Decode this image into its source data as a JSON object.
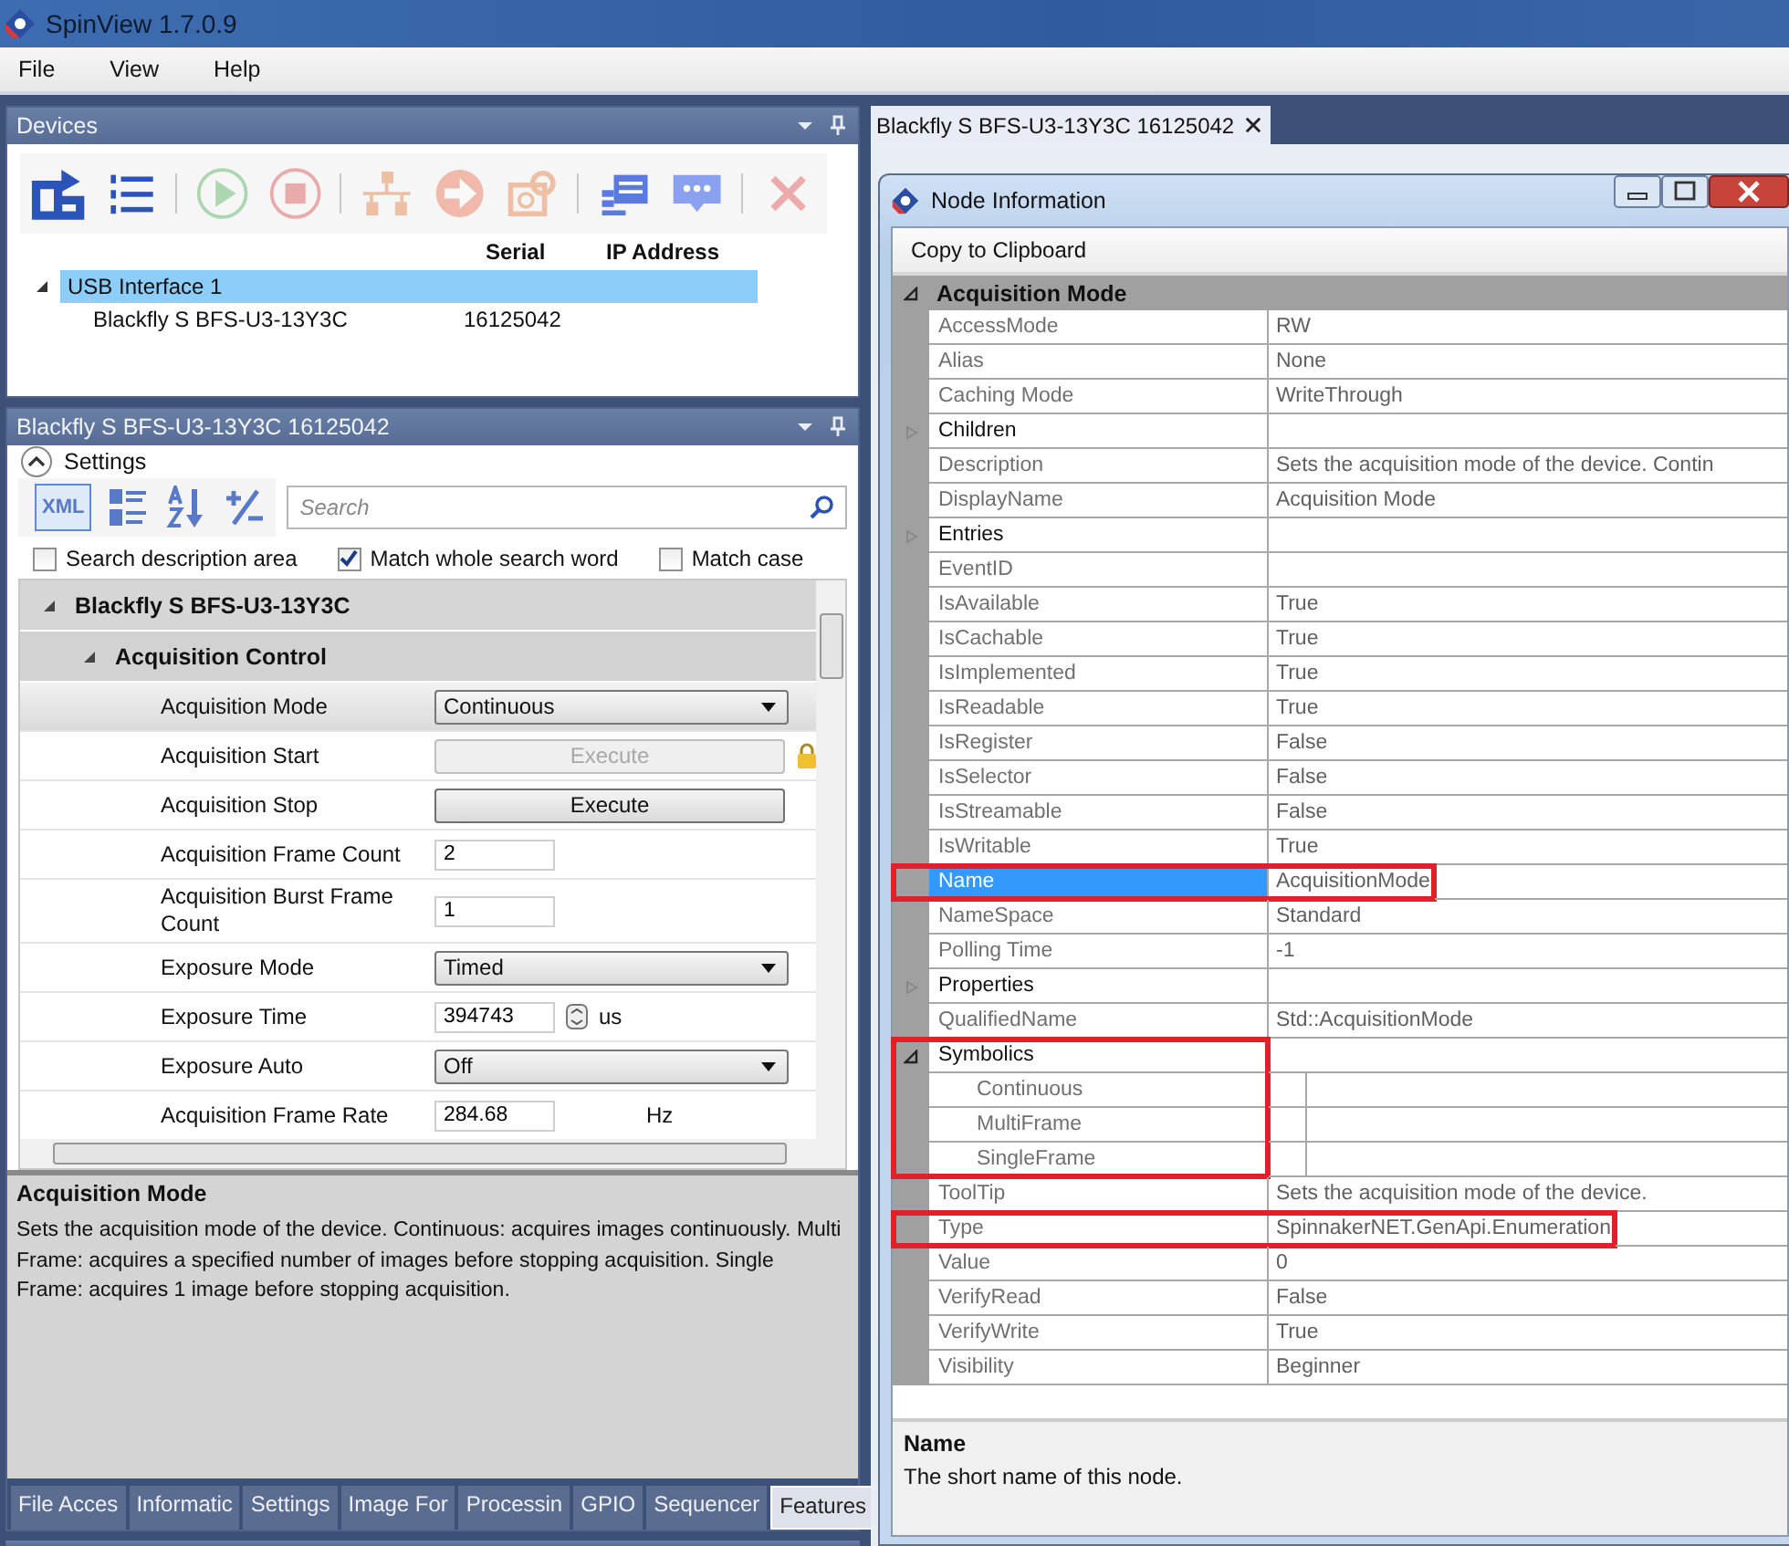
{
  "window": {
    "title": "SpinView 1.7.0.9"
  },
  "menu": [
    "File",
    "View",
    "Help"
  ],
  "devices_panel": {
    "title": "Devices",
    "toolbar": [
      {
        "kind": "refresh",
        "disabled": false,
        "separator_after": false
      },
      {
        "kind": "list",
        "disabled": false,
        "separator_after": true
      },
      {
        "kind": "play",
        "disabled": true,
        "separator_after": false
      },
      {
        "kind": "stop",
        "disabled": true,
        "separator_after": true
      },
      {
        "kind": "network",
        "disabled": true,
        "separator_after": false
      },
      {
        "kind": "forward",
        "disabled": true,
        "separator_after": false
      },
      {
        "kind": "configure",
        "disabled": true,
        "separator_after": true
      },
      {
        "kind": "details",
        "disabled": false,
        "separator_after": false
      },
      {
        "kind": "chat",
        "disabled": false,
        "separator_after": true
      },
      {
        "kind": "remove",
        "disabled": true,
        "separator_after": false
      }
    ],
    "columns": [
      "Serial",
      "IP Address"
    ],
    "tree": [
      {
        "name": "USB Interface 1",
        "expanded": true,
        "selected": true,
        "children": [
          {
            "name": "Blackfly S BFS-U3-13Y3C",
            "serial": "16125042",
            "selected": false
          }
        ]
      }
    ]
  },
  "camera_panel": {
    "title": "Blackfly S BFS-U3-13Y3C 16125042",
    "section": {
      "label": "Settings",
      "expanded": true
    },
    "view_buttons": [
      {
        "kind": "xml",
        "label": "XML",
        "selected": true
      },
      {
        "kind": "categorized",
        "selected": false
      },
      {
        "kind": "sort",
        "selected": false
      },
      {
        "kind": "plus-minus",
        "selected": false
      }
    ],
    "search": {
      "placeholder": "Search"
    },
    "options": [
      {
        "label": "Search description area",
        "checked": false
      },
      {
        "label": "Match whole search word",
        "checked": true
      },
      {
        "label": "Match case",
        "checked": false
      }
    ],
    "tree": [
      {
        "name": "Blackfly S BFS-U3-13Y3C",
        "expanded": true,
        "children": [
          {
            "name": "Acquisition Control",
            "expanded": true,
            "children": [
              {
                "kind": "dropdown",
                "label": "Acquisition Mode",
                "value": "Continuous",
                "selected": true
              },
              {
                "kind": "button",
                "label": "Acquisition Start",
                "button": "Execute",
                "disabled": true,
                "locked": true,
                "selected": false
              },
              {
                "kind": "button",
                "label": "Acquisition Stop",
                "button": "Execute",
                "disabled": false,
                "locked": false,
                "selected": false
              },
              {
                "kind": "number",
                "label": "Acquisition Frame Count",
                "value": "2",
                "selected": false
              },
              {
                "kind": "number",
                "label": "Acquisition Burst Frame Count",
                "value": "1",
                "selected": false
              },
              {
                "kind": "dropdown",
                "label": "Exposure Mode",
                "value": "Timed",
                "selected": false
              },
              {
                "kind": "spin",
                "label": "Exposure Time",
                "value": "394743",
                "unit": "us",
                "selected": false
              },
              {
                "kind": "dropdown",
                "label": "Exposure Auto",
                "value": "Off",
                "selected": false
              },
              {
                "kind": "number",
                "label": "Acquisition Frame Rate",
                "value": "284.68",
                "unit": "Hz",
                "selected": false
              }
            ]
          }
        ]
      }
    ],
    "description": {
      "title": "Acquisition Mode",
      "text": "Sets the acquisition mode of the device. Continuous: acquires images continuously. Multi Frame: acquires a specified number of images before stopping acquisition. Single Frame: acquires 1 image before stopping acquisition."
    },
    "tabs": [
      {
        "label": "File Acces",
        "selected": false
      },
      {
        "label": "Informatic",
        "selected": false
      },
      {
        "label": "Settings",
        "selected": false
      },
      {
        "label": "Image For",
        "selected": false
      },
      {
        "label": "Processin",
        "selected": false
      },
      {
        "label": "GPIO",
        "selected": false
      },
      {
        "label": "Sequencer",
        "selected": false
      },
      {
        "label": "Features",
        "selected": true
      }
    ]
  },
  "document_tab": {
    "title": "Blackfly S BFS-U3-13Y3C 16125042"
  },
  "node_info": {
    "title": "Node Information",
    "toolbar": [
      "Copy to Clipboard"
    ],
    "section": {
      "name": "Acquisition Mode",
      "expanded": true
    },
    "rows": [
      {
        "kind": "property",
        "key": "AccessMode",
        "value": "RW",
        "selected": false,
        "highlighted": false
      },
      {
        "kind": "property",
        "key": "Alias",
        "value": "None",
        "selected": false,
        "highlighted": false
      },
      {
        "kind": "property",
        "key": "Caching Mode",
        "value": "WriteThrough",
        "selected": false,
        "highlighted": false
      },
      {
        "kind": "group",
        "key": "Children",
        "expanded": false,
        "highlighted": false
      },
      {
        "kind": "property",
        "key": "Description",
        "value": "Sets the acquisition mode of the device. Contin",
        "selected": false,
        "highlighted": false
      },
      {
        "kind": "property",
        "key": "DisplayName",
        "value": "Acquisition Mode",
        "selected": false,
        "highlighted": false
      },
      {
        "kind": "group",
        "key": "Entries",
        "expanded": false,
        "highlighted": false
      },
      {
        "kind": "property",
        "key": "EventID",
        "selected": false,
        "highlighted": false
      },
      {
        "kind": "property",
        "key": "IsAvailable",
        "value": "True",
        "selected": false,
        "highlighted": false
      },
      {
        "kind": "property",
        "key": "IsCachable",
        "value": "True",
        "selected": false,
        "highlighted": false
      },
      {
        "kind": "property",
        "key": "IsImplemented",
        "value": "True",
        "selected": false,
        "highlighted": false
      },
      {
        "kind": "property",
        "key": "IsReadable",
        "value": "True",
        "selected": false,
        "highlighted": false
      },
      {
        "kind": "property",
        "key": "IsRegister",
        "value": "False",
        "selected": false,
        "highlighted": false
      },
      {
        "kind": "property",
        "key": "IsSelector",
        "value": "False",
        "selected": false,
        "highlighted": false
      },
      {
        "kind": "property",
        "key": "IsStreamable",
        "value": "False",
        "selected": false,
        "highlighted": false
      },
      {
        "kind": "property",
        "key": "IsWritable",
        "value": "True",
        "selected": false,
        "highlighted": false
      },
      {
        "kind": "property",
        "key": "Name",
        "value": "AcquisitionMode",
        "selected": true,
        "highlighted": true
      },
      {
        "kind": "property",
        "key": "NameSpace",
        "value": "Standard",
        "selected": false,
        "highlighted": false
      },
      {
        "kind": "property",
        "key": "Polling Time",
        "value": "-1",
        "selected": false,
        "highlighted": false
      },
      {
        "kind": "group",
        "key": "Properties",
        "expanded": false,
        "highlighted": false
      },
      {
        "kind": "property",
        "key": "QualifiedName",
        "value": "Std::AcquisitionMode",
        "selected": false,
        "highlighted": false
      },
      {
        "kind": "group",
        "key": "Symbolics",
        "expanded": true,
        "highlighted": true,
        "children": [
          {
            "key": "Continuous"
          },
          {
            "key": "MultiFrame"
          },
          {
            "key": "SingleFrame"
          }
        ]
      },
      {
        "kind": "property",
        "key": "ToolTip",
        "value": "Sets the acquisition mode of the device.",
        "selected": false,
        "highlighted": false
      },
      {
        "kind": "property",
        "key": "Type",
        "value": "SpinnakerNET.GenApi.Enumeration",
        "selected": false,
        "highlighted": true
      },
      {
        "kind": "property",
        "key": "Value",
        "value": "0",
        "selected": false,
        "highlighted": false
      },
      {
        "kind": "property",
        "key": "VerifyRead",
        "value": "False",
        "selected": false,
        "highlighted": false
      },
      {
        "kind": "property",
        "key": "VerifyWrite",
        "value": "True",
        "selected": false,
        "highlighted": false
      },
      {
        "kind": "property",
        "key": "Visibility",
        "value": "Beginner",
        "selected": false,
        "highlighted": false
      }
    ],
    "help": {
      "title": "Name",
      "text": "The short name of this node."
    }
  }
}
